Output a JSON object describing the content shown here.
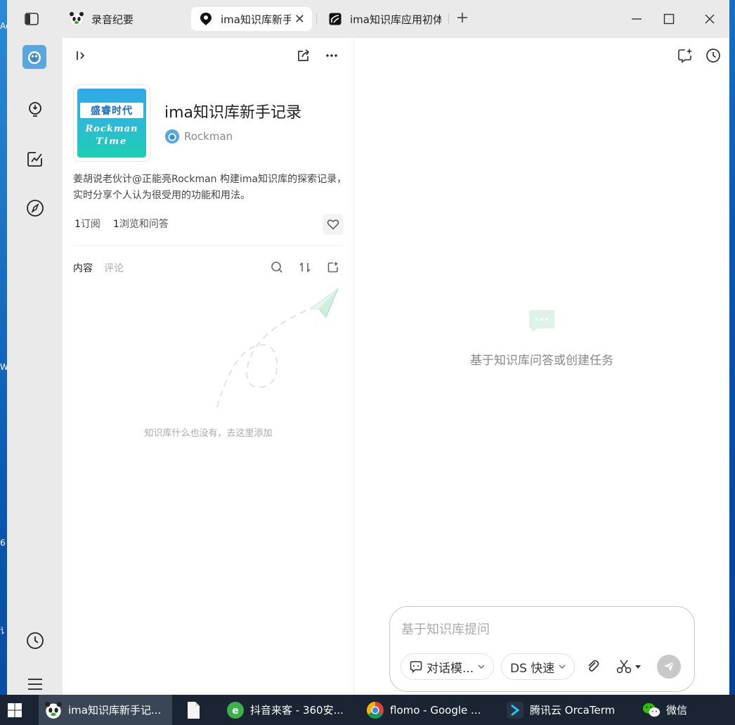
{
  "tabs": [
    {
      "label": "录音纪要",
      "icon": "panda-icon"
    },
    {
      "label": "ima知识库新手",
      "icon": "ima-logo-icon"
    },
    {
      "label": "ima知识库应用初体",
      "icon": "notion-logo-icon"
    }
  ],
  "new_tab_label": "+",
  "close_tab_label": "✕",
  "knowledge_base": {
    "title": "ima知识库新手记录",
    "author": "Rockman",
    "cover_top_text": "盛睿时代",
    "cover_line1": "Rockman",
    "cover_line2": "Time",
    "description": "姜胡说老伙计@正能亮Rockman 构建ima知识库的探索记录，实时分享个人认为很受用的功能和用法。",
    "subscribe_count": "1",
    "subscribe_label": "订阅",
    "views_count": "1",
    "views_label": "浏览和问答"
  },
  "content_tabs": {
    "content": "内容",
    "comments": "评论"
  },
  "empty_state": "知识库什么也没有，去这里添加",
  "chat": {
    "empty_text": "基于知识库问答或创建任务",
    "input_placeholder": "基于知识库提问",
    "mode_label": "对话模...",
    "model_label": "DS 快速"
  },
  "taskbar": [
    {
      "label": "ima知识库新手记...",
      "icon": "panda-icon"
    },
    {
      "label": "",
      "icon": "file-icon"
    },
    {
      "label": "抖音来客 - 360安...",
      "icon": "360-browser-icon"
    },
    {
      "label": "flomo - Google ...",
      "icon": "chrome-icon"
    },
    {
      "label": "腾讯云 OrcaTerm",
      "icon": "orcaterm-icon"
    },
    {
      "label": "微信",
      "icon": "wechat-icon"
    }
  ],
  "colors": {
    "accent": "#1d9be8",
    "panel_bg": "#eaeaea",
    "taskbar": "#1b2432"
  }
}
